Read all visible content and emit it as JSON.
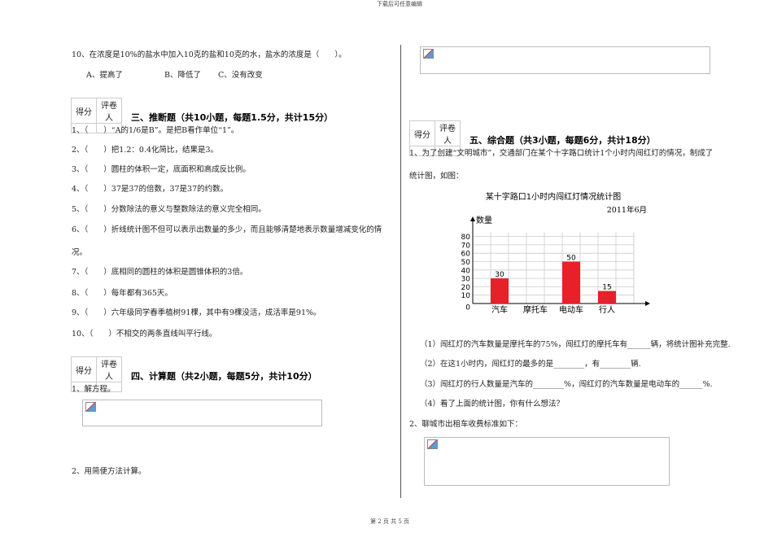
{
  "header": "下载后可任意编辑",
  "footer": "第 2 页 共 5 页",
  "score_table": {
    "col1": "得分",
    "col2": "评卷人"
  },
  "left": {
    "q10": "10、在浓度是10%的盐水中加入10克的盐和10克的水，盐水的浓度是（　　）。",
    "q10_options": [
      "A、提高了",
      "B、降低了",
      "C、没有改变"
    ],
    "section3_title": "三、推断题（共10小题，每题1.5分，共计15分）",
    "section3_items": [
      "1、（　　）“A的1/6是B”。是把B看作单位“1”。",
      "2、（　　）把1.2：0.4化简比，结果是3。",
      "3、（　　）圆柱的体积一定，底面积和高成反比例。",
      "4、（　　）37是37的倍数，37是37的约数。",
      "5、（　　）分数除法的意义与整数除法的意义完全相同。",
      "6、（　　）折线统计图不但可以表示出数量的多少，而且能够清楚地表示数量增减变化的情",
      "况。",
      "7、（　　）底相同的圆柱的体积是圆锥体积的3倍。",
      "8、（　　）每年都有365天。",
      "9、（　　）六年级同学春季植树91棵，其中有9棵没活，成活率是91%。",
      "10、（　　）不相交的两条直线叫平行线。"
    ],
    "section4_title": "四、计算题（共2小题，每题5分，共计10分）",
    "s4_q1": "1、解方程。",
    "s4_q2": "2、用简便方法计算。"
  },
  "right": {
    "section5_title": "五、综合题（共3小题，每题6分，共计18分）",
    "q1_line1": "1、为了创建“文明城市”，交通部门在某个十字路口统计1个小时内闯红灯的情况，制成了",
    "q1_line2": "统计图，如图：",
    "sub_questions": [
      "（1）闯红灯的汽车数量是摩托车的75%，闯红灯的摩托车有______辆，将统计图补充完整.",
      "（2）在这1小时内，闯红灯的最多的是________，有________辆.",
      "（3）闯红灯的行人数量是汽车的________%，闯红灯的汽车数量是电动车的______%.",
      "（4）看了上面的统计图，你有什么想法？"
    ],
    "q2": "2、聊城市出租车收费标准如下："
  },
  "chart_data": {
    "type": "bar",
    "title": "某十字路口1小时内闯红灯情况统计图",
    "subtitle": "2011年6月",
    "ylabel": "数量",
    "xlabel": "",
    "categories": [
      "汽车",
      "摩托车",
      "电动车",
      "行人"
    ],
    "values": [
      30,
      null,
      50,
      15
    ],
    "ylim": [
      0,
      80
    ],
    "yticks": [
      0,
      10,
      20,
      30,
      40,
      50,
      60,
      70,
      80
    ],
    "grid": true,
    "bar_color": "#e8202a"
  }
}
